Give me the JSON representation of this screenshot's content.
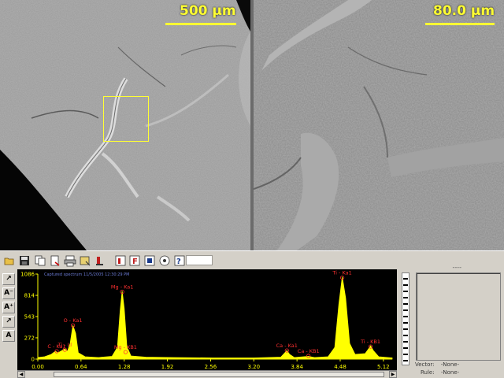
{
  "micrographs": {
    "left": {
      "scale_label": "500 µm"
    },
    "right": {
      "scale_label": "80.0 µm"
    }
  },
  "toolbar": {
    "status": "----"
  },
  "tools": [
    {
      "label": "↗"
    },
    {
      "label": "A⁻"
    },
    {
      "label": "A⁺"
    },
    {
      "label": "↗"
    },
    {
      "label": "A"
    }
  ],
  "spectrum": {
    "caption": "Captured spectrum 11/5/2005 12:30:29 PM",
    "colors": {
      "background": "#000000",
      "peak": "#ffff00",
      "axis": "#ffff00",
      "label": "#ff3030"
    }
  },
  "chart_data": {
    "type": "line",
    "x_ticks": [
      "0.00",
      "0.64",
      "1.28",
      "1.92",
      "2.56",
      "3.20",
      "3.84",
      "4.48",
      "5.12"
    ],
    "y_ticks": [
      "1086",
      "814",
      "543",
      "272",
      "0"
    ],
    "xlim": [
      0.0,
      5.25
    ],
    "ylim": [
      0,
      1086
    ],
    "peak_labels": [
      {
        "label": "C - Ka1",
        "x": 0.28,
        "y": 100
      },
      {
        "label": "Ti - Ll",
        "x": 0.4,
        "y": 120
      },
      {
        "label": "O - Ka1",
        "x": 0.52,
        "y": 430
      },
      {
        "label": "Mg - Ka1",
        "x": 1.25,
        "y": 860
      },
      {
        "label": "Mg - KB1",
        "x": 1.3,
        "y": 90
      },
      {
        "label": "Ca - Ka1",
        "x": 3.69,
        "y": 110
      },
      {
        "label": "Ca - KB1",
        "x": 4.01,
        "y": 40
      },
      {
        "label": "Ti - Ka1",
        "x": 4.51,
        "y": 1040
      },
      {
        "label": "Ti - KB1",
        "x": 4.93,
        "y": 160
      }
    ],
    "spectrum_points": [
      [
        0.0,
        20
      ],
      [
        0.1,
        30
      ],
      [
        0.2,
        60
      ],
      [
        0.26,
        100
      ],
      [
        0.3,
        80
      ],
      [
        0.36,
        110
      ],
      [
        0.4,
        130
      ],
      [
        0.44,
        100
      ],
      [
        0.48,
        200
      ],
      [
        0.52,
        430
      ],
      [
        0.56,
        330
      ],
      [
        0.6,
        80
      ],
      [
        0.7,
        30
      ],
      [
        0.9,
        20
      ],
      [
        1.1,
        35
      ],
      [
        1.18,
        150
      ],
      [
        1.22,
        620
      ],
      [
        1.25,
        870
      ],
      [
        1.28,
        650
      ],
      [
        1.32,
        160
      ],
      [
        1.38,
        40
      ],
      [
        1.6,
        25
      ],
      [
        2.0,
        20
      ],
      [
        2.6,
        15
      ],
      [
        3.2,
        15
      ],
      [
        3.6,
        25
      ],
      [
        3.66,
        80
      ],
      [
        3.69,
        110
      ],
      [
        3.73,
        60
      ],
      [
        3.8,
        20
      ],
      [
        4.01,
        35
      ],
      [
        4.1,
        20
      ],
      [
        4.3,
        30
      ],
      [
        4.4,
        150
      ],
      [
        4.46,
        700
      ],
      [
        4.51,
        1050
      ],
      [
        4.56,
        780
      ],
      [
        4.62,
        200
      ],
      [
        4.7,
        60
      ],
      [
        4.85,
        70
      ],
      [
        4.9,
        130
      ],
      [
        4.93,
        170
      ],
      [
        4.97,
        110
      ],
      [
        5.05,
        30
      ],
      [
        5.25,
        15
      ]
    ]
  },
  "info_panel": {
    "vector_label": "Vector:",
    "vector_value": "-None-",
    "rule_label": "Rule:",
    "rule_value": "-None-"
  }
}
